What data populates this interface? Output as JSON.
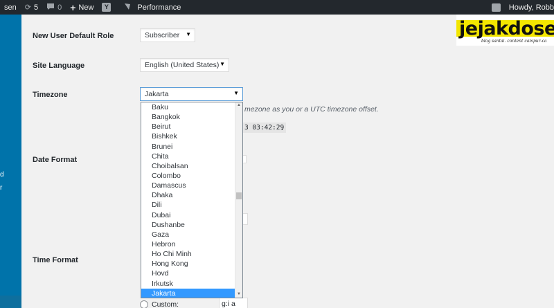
{
  "adminbar": {
    "site_fragment": "sen",
    "updates_count": "5",
    "comments_count": "0",
    "new_label": "New",
    "yoast_letter": "Y",
    "performance_label": "Performance",
    "greeting": "Howdy, Robb"
  },
  "sidebar": {
    "label_1": "d",
    "label_2": "r"
  },
  "settings": {
    "new_user_role_label": "New User Default Role",
    "new_user_role_value": "Subscriber",
    "site_language_label": "Site Language",
    "site_language_value": "English (United States)",
    "timezone_label": "Timezone",
    "timezone_value": "Jakarta",
    "timezone_description": "mezone as you or a UTC timezone offset.",
    "local_time_fragment": "3 03:42:29",
    "local_time_period": ".",
    "date_format_label": "Date Format",
    "time_format_label": "Time Format",
    "custom_label": "Custom:",
    "custom_time_value": "g:i a"
  },
  "timezone_options": [
    "Baku",
    "Bangkok",
    "Beirut",
    "Bishkek",
    "Brunei",
    "Chita",
    "Choibalsan",
    "Colombo",
    "Damascus",
    "Dhaka",
    "Dili",
    "Dubai",
    "Dushanbe",
    "Gaza",
    "Hebron",
    "Ho Chi Minh",
    "Hong Kong",
    "Hovd",
    "Irkutsk",
    "Jakarta"
  ],
  "selected_timezone_option": "Jakarta",
  "logo": {
    "text": "jejakdose",
    "tagline": "blog santai. content campur-ca"
  },
  "colors": {
    "adminbar_bg": "#23282d",
    "sidebar_bg": "#0073aa",
    "selection": "#3399ff",
    "logo_band": "#f3e600"
  }
}
